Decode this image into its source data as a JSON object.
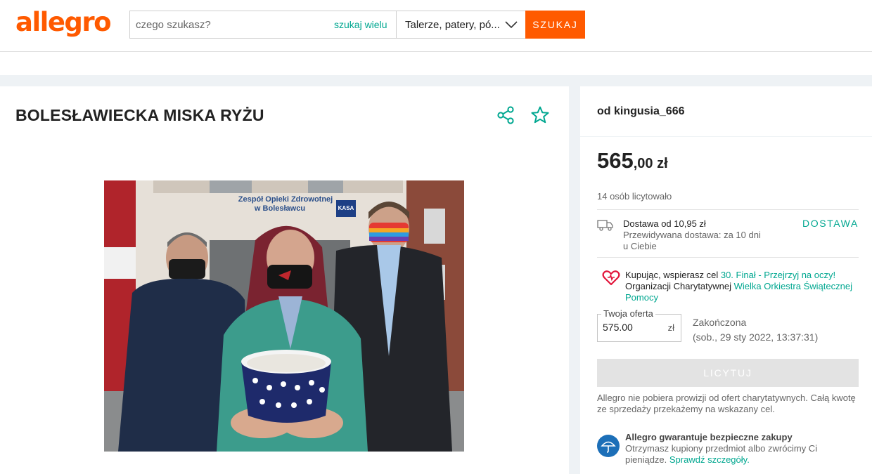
{
  "brand": {
    "logo_text": "allegro",
    "accent_color": "#ff5a00",
    "link_color": "#00a790"
  },
  "search": {
    "placeholder": "czego szukasz?",
    "value": "",
    "multi_search_label": "szukaj wielu",
    "category_selected": "Talerze, patery, pó...",
    "button_label": "SZUKAJ"
  },
  "product": {
    "title": "BOLESŁAWIECKA MISKA RYŻU",
    "icons": [
      "share-icon",
      "star-icon"
    ],
    "photo_sign": {
      "line1": "Zespół Opieki Zdrowotnej",
      "line2": "w Bolesławcu",
      "kasa": "KASA"
    }
  },
  "seller": {
    "label": "od kingusia_666"
  },
  "offer": {
    "price_main": "565",
    "price_rest": ",00 zł",
    "bidders": "14 osób licytowało",
    "delivery": {
      "price": "Dostawa od 10,95 zł",
      "estimate_line1": "Przewidywana dostawa: za 10 dni",
      "estimate_line2": "u Ciebie",
      "link": "DOSTAWA"
    },
    "charity": {
      "text1": "Kupując, wspierasz cel ",
      "goal_link": "30. Finał - Przejrzyj na oczy!",
      "text2": " Organizacji Charytatywnej ",
      "org_link": "Wielka Orkiestra Świątecznej Pomocy"
    },
    "bid_field": {
      "label": "Twoja oferta",
      "value": "575.00",
      "currency": "zł"
    },
    "status": "Zakończona",
    "end_date": "(sob., 29 sty 2022, 13:37:31)",
    "bid_button": "LICYTUJ",
    "fee_note": "Allegro nie pobiera prowizji od ofert charytatywnych. Całą kwotę ze sprzedaży przekażemy na wskazany cel.",
    "guarantee": {
      "title": "Allegro gwarantuje bezpieczne zakupy",
      "text": "Otrzymasz kupiony przedmiot albo zwrócimy Ci pieniądze. ",
      "link": "Sprawdź szczegóły."
    }
  }
}
